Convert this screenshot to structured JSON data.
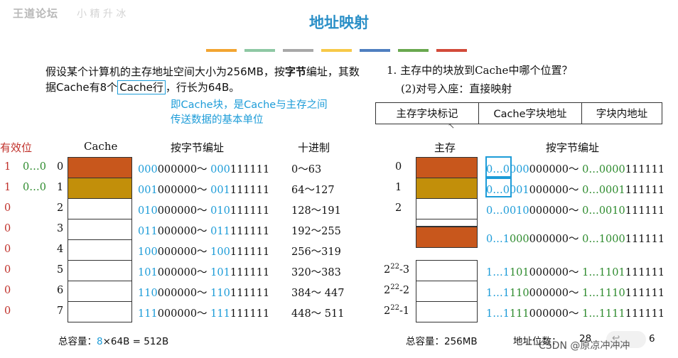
{
  "logo": {
    "text": "王道论坛",
    "deco": "小 精 升 冰"
  },
  "title": "地址映射",
  "accent_bars": [
    "#f2a531",
    "#8ec8a4",
    "#a8a8a8",
    "#f7c948",
    "#4f7fc0",
    "#69a84f",
    "#d24a3a"
  ],
  "intro": {
    "part1": "假设某个计算机的主存地址空间大小为256MB，按",
    "bold": "字节",
    "part2": "编址，其数据Cache有8个",
    "boxed": "Cache行",
    "part3": "，行长为64B。"
  },
  "note": {
    "line1": "即Cache块，是Cache与主存之间",
    "line2": "传送数据的基本单位"
  },
  "question": {
    "q1": "1. 主存中的块放到Cache中哪个位置？",
    "q2": "(2)对号入座：直接映射"
  },
  "address_table": [
    "主存字块标记",
    "Cache字块地址",
    "字块内地址"
  ],
  "headers": {
    "valid": "有效位",
    "cache": "Cache",
    "addr": "按字节编址",
    "decimal": "十进制",
    "main": "主存",
    "main_addr": "按字节编址"
  },
  "colors": {
    "orange": "#c8571c",
    "gold": "#c28f0a",
    "blue": "#1d9cd8",
    "green": "#2e8b2e",
    "red": "#c0302a"
  },
  "cache_rows": [
    {
      "valid": "1",
      "tag": "0…0",
      "index": "0",
      "addr_a": "000",
      "addr_b": "000000",
      "addr_c": "000",
      "addr_d": "111111",
      "dec": "0～63",
      "fill": "orange"
    },
    {
      "valid": "1",
      "tag": "0…0",
      "index": "1",
      "addr_a": "001",
      "addr_b": "000000",
      "addr_c": "001",
      "addr_d": "111111",
      "dec": "64～127",
      "fill": "gold"
    },
    {
      "valid": "0",
      "tag": "",
      "index": "2",
      "addr_a": "010",
      "addr_b": "000000",
      "addr_c": "010",
      "addr_d": "111111",
      "dec": "128～191",
      "fill": ""
    },
    {
      "valid": "0",
      "tag": "",
      "index": "3",
      "addr_a": "011",
      "addr_b": "000000",
      "addr_c": "011",
      "addr_d": "111111",
      "dec": "192～255",
      "fill": ""
    },
    {
      "valid": "0",
      "tag": "",
      "index": "4",
      "addr_a": "100",
      "addr_b": "000000",
      "addr_c": "100",
      "addr_d": "111111",
      "dec": "256～319",
      "fill": ""
    },
    {
      "valid": "0",
      "tag": "",
      "index": "5",
      "addr_a": "101",
      "addr_b": "000000",
      "addr_c": "101",
      "addr_d": "111111",
      "dec": "320～383",
      "fill": ""
    },
    {
      "valid": "0",
      "tag": "",
      "index": "6",
      "addr_a": "110",
      "addr_b": "000000",
      "addr_c": "110",
      "addr_d": "111111",
      "dec": "384～ 447",
      "fill": ""
    },
    {
      "valid": "0",
      "tag": "",
      "index": "7",
      "addr_a": "111",
      "addr_b": "000000",
      "addr_c": "111",
      "addr_d": "111111",
      "dec": "448～ 511",
      "fill": ""
    }
  ],
  "main_rows": [
    {
      "label": "0",
      "a1": "0…0",
      "a2": "000",
      "a3": "000000～ ",
      "a4": "0…0000",
      "a5": "111111",
      "fill": "orange"
    },
    {
      "label": "1",
      "a1": "0…0",
      "a2": "001",
      "a3": "000000～ ",
      "a4": "0…0001",
      "a5": "111111",
      "fill": "gold"
    },
    {
      "label": "2",
      "a1": "0…0",
      "a2": "010",
      "a3": "000000～ ",
      "a4": "0…0010",
      "a5": "111111",
      "fill": ""
    },
    {
      "label": "",
      "a1": "0…1",
      "a2": "000",
      "a3": "000000～ ",
      "a4": "0…1000",
      "a5": "111111",
      "fill": "orange"
    },
    {
      "label": "-3",
      "a1": "1…1",
      "a2": "101",
      "a3": "000000～ ",
      "a4": "1…1101",
      "a5": "111111",
      "fill": ""
    },
    {
      "label": "-2",
      "a1": "1…1",
      "a2": "110",
      "a3": "000000～ ",
      "a4": "1…1110",
      "a5": "111111",
      "fill": ""
    },
    {
      "label": "-1",
      "a1": "1…1",
      "a2": "111",
      "a3": "000000～ ",
      "a4": "1…1111",
      "a5": "111111",
      "fill": ""
    }
  ],
  "pow": {
    "base": "2",
    "exp": "22"
  },
  "cache_total": {
    "label": "总容量：",
    "n": "8",
    "rest": "×64B = 512B"
  },
  "main_total": {
    "label": "总容量：",
    "value": "256MB",
    "bits_label": "地址位数：",
    "bits": "28",
    "extra": "6"
  },
  "watermark": "CSDN @原凉冲冲冲"
}
